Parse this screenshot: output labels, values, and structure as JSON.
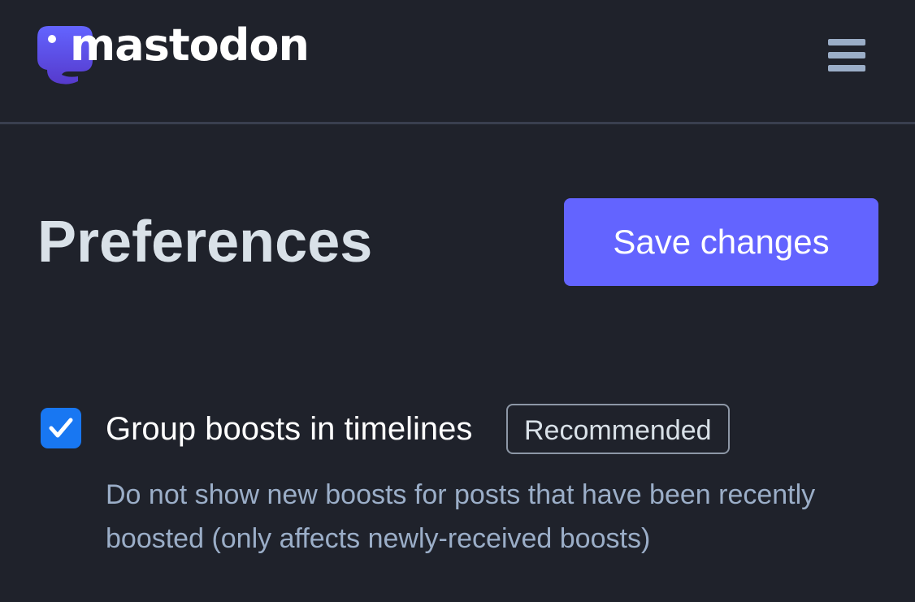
{
  "brand": {
    "name": "mastodon",
    "colors": {
      "background": "#1f222b",
      "accent": "#6364ff",
      "checkbox": "#1877f2",
      "logo_gradient": [
        "#6364ff",
        "#563acc"
      ]
    }
  },
  "header": {
    "menu_icon": "hamburger-menu-icon"
  },
  "main": {
    "title": "Preferences",
    "save_label": "Save changes"
  },
  "preferences": [
    {
      "label": "Group boosts in timelines",
      "badge": "Recommended",
      "checked": true,
      "hint": "Do not show new boosts for posts that have been recently boosted (only affects newly-received boosts)",
      "icon": "checkmark-icon"
    }
  ]
}
